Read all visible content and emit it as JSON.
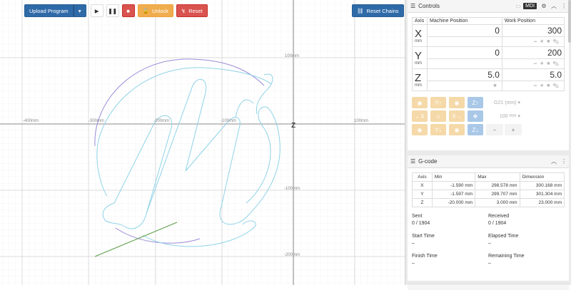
{
  "toolbar": {
    "upload_label": "Upload Program",
    "unlock_label": "Unlock",
    "reset_label": "Reset",
    "reset_chains_label": "Reset Chains",
    "icons": [
      "play-icon",
      "pause-icon",
      "stop-icon",
      "lock-icon",
      "reset-icon",
      "chain-icon"
    ]
  },
  "visualizer": {
    "x_labels": [
      "-400mm",
      "-300mm",
      "-200mm",
      "-100mm",
      "100mm"
    ],
    "y_labels": [
      "100mm",
      "-100mm",
      "-200mm"
    ],
    "origin_label": "Z",
    "colors": {
      "grid": "#e4e4e4",
      "axis": "#555555",
      "toolpath": "#8fd3e8",
      "arc": "#9b8ad8",
      "tool_line": "#5b9e4a"
    }
  },
  "controls": {
    "title": "Controls",
    "mdi_label": "MDI",
    "headers": [
      "Axis",
      "Machine Position",
      "Work Position"
    ],
    "axes": [
      {
        "axis": "X",
        "unit": "mm",
        "machine": "0",
        "work": "300"
      },
      {
        "axis": "Y",
        "unit": "mm",
        "machine": "0",
        "work": "200"
      },
      {
        "axis": "Z",
        "unit": "mm",
        "machine": "5.0",
        "work": "5.0"
      }
    ],
    "units_select": "G21 (mm)",
    "step_select": "100",
    "step_unit": "mm",
    "minus_label": "−",
    "plus_label": "+"
  },
  "gcode": {
    "title": "G-code",
    "headers": [
      "Axis",
      "Min",
      "Max",
      "Dimension"
    ],
    "rows": [
      {
        "axis": "X",
        "min": "-1.590 mm",
        "max": "298.578 mm",
        "dim": "300.168 mm"
      },
      {
        "axis": "Y",
        "min": "-1.597 mm",
        "max": "299.707 mm",
        "dim": "301.304 mm"
      },
      {
        "axis": "Z",
        "min": "-20.000 mm",
        "max": "3.000 mm",
        "dim": "23.000 mm"
      }
    ],
    "stats": {
      "sent_label": "Sent",
      "sent_value": "0 / 1904",
      "received_label": "Received",
      "received_value": "0 / 1904",
      "start_label": "Start Time",
      "start_value": "–",
      "elapsed_label": "Elapsed Time",
      "elapsed_value": "–",
      "finish_label": "Finish Time",
      "finish_value": "–",
      "remaining_label": "Remaining Time",
      "remaining_value": "–"
    }
  }
}
